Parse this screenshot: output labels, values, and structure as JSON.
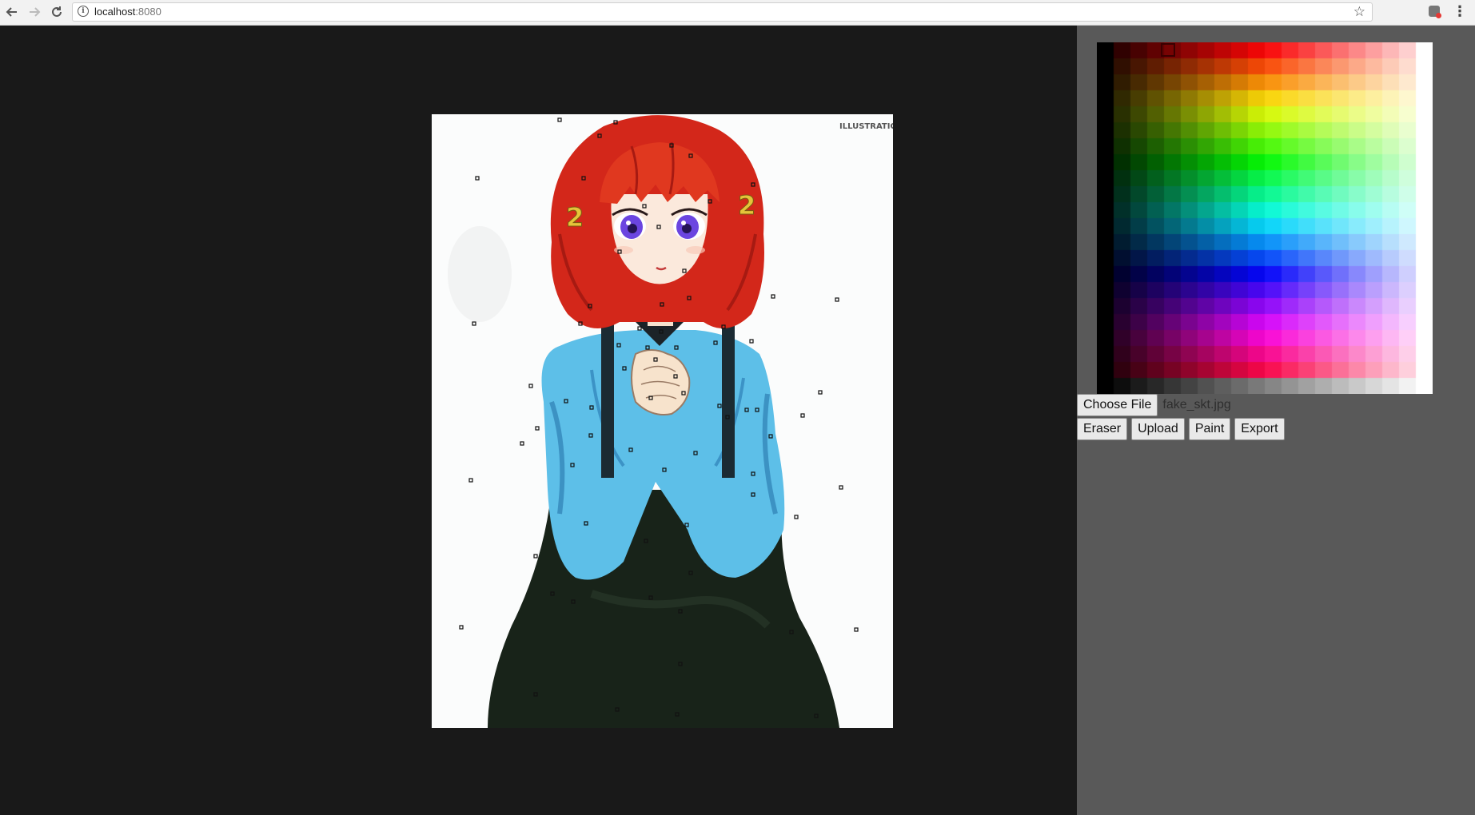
{
  "browser": {
    "host": "localhost",
    "port": ":8080",
    "icons": [
      "back-arrow-icon",
      "forward-arrow-icon",
      "reload-icon",
      "info-icon",
      "star-icon",
      "extension-icon",
      "menu-dots-icon"
    ]
  },
  "palette": {
    "colors": {
      "left_edge": "#000000",
      "right_edge": "#ffffff",
      "selected": "#8b0a1c"
    }
  },
  "file": {
    "choose_label": "Choose File",
    "filename": "fake_skt.jpg"
  },
  "toolbar": {
    "eraser_label": "Eraser",
    "upload_label": "Upload",
    "paint_label": "Paint",
    "export_label": "Export"
  },
  "canvas": {
    "image": "anime girl sketch with red hair and blue jacket",
    "watermark": "ILLUSTRATION"
  }
}
